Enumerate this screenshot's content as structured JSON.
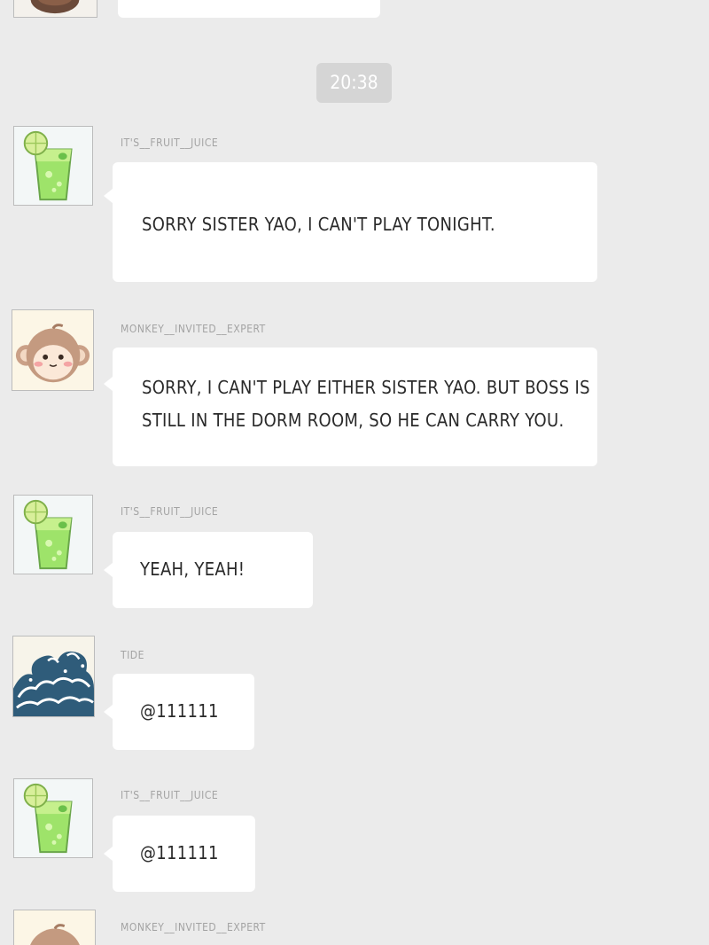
{
  "timestamp": "20:38",
  "messages": [
    {
      "sender": "IT'S__FRUIT__JUICE",
      "avatar_icon": "fruit-juice-avatar-icon",
      "text": "SORRY SISTER YAO, I CAN'T PLAY TONIGHT."
    },
    {
      "sender": "MONKEY__INVITED__EXPERT",
      "avatar_icon": "monkey-avatar-icon",
      "text": "SORRY, I CAN'T PLAY EITHER SISTER YAO. BUT BOSS IS\nSTILL IN THE DORM ROOM, SO HE CAN CARRY YOU."
    },
    {
      "sender": "IT'S__FRUIT__JUICE",
      "avatar_icon": "fruit-juice-avatar-icon",
      "text": "YEAH, YEAH!"
    },
    {
      "sender": "TIDE",
      "avatar_icon": "wave-avatar-icon",
      "text": "@111111"
    },
    {
      "sender": "IT'S__FRUIT__JUICE",
      "avatar_icon": "fruit-juice-avatar-icon",
      "text": "@111111"
    },
    {
      "sender": "MONKEY__INVITED__EXPERT",
      "avatar_icon": "monkey-avatar-icon",
      "text": ""
    }
  ],
  "colors": {
    "background": "#ebebeb",
    "bubble": "#ffffff",
    "name_text": "#a3a3a3",
    "message_text": "#2a2a2a",
    "time_badge": "#d5d5d5"
  }
}
